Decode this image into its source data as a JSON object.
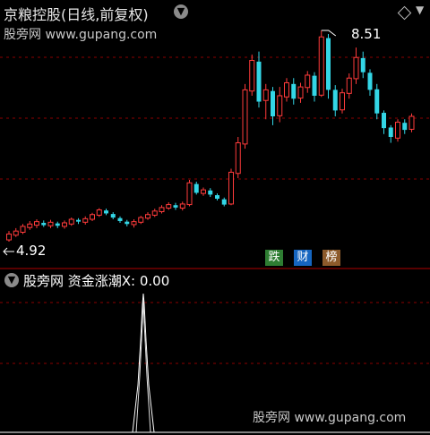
{
  "header": {
    "title": "京粮控股(日线,前复权)"
  },
  "watermark": {
    "top": "股旁网 www.gupang.com",
    "bottom": "股旁网 www.gupang.com"
  },
  "price_labels": {
    "high": "8.51",
    "low": "4.92"
  },
  "badges": [
    "跌",
    "财",
    "榜"
  ],
  "indicator": {
    "title": "股旁网 资金涨潮X: 0.00"
  },
  "icons": {
    "dropdown": "chevron-down-icon",
    "window": "diamond-icon"
  },
  "colors": {
    "up": "#ff3b3b",
    "down": "#33d6e6",
    "grid": "#8b0000",
    "separator": "#b00000"
  },
  "chart_data": {
    "type": "candlestick",
    "ylim": [
      4.92,
      8.51
    ],
    "high": 8.51,
    "low": 4.92,
    "candles": [
      [
        4.95,
        5.05,
        4.92,
        5.1
      ],
      [
        5.03,
        5.1,
        5.0,
        5.15
      ],
      [
        5.08,
        5.18,
        5.05,
        5.22
      ],
      [
        5.16,
        5.22,
        5.12,
        5.27
      ],
      [
        5.2,
        5.26,
        5.15,
        5.3
      ],
      [
        5.24,
        5.2,
        5.17,
        5.28
      ],
      [
        5.19,
        5.25,
        5.15,
        5.29
      ],
      [
        5.23,
        5.19,
        5.15,
        5.26
      ],
      [
        5.18,
        5.24,
        5.14,
        5.28
      ],
      [
        5.22,
        5.3,
        5.19,
        5.33
      ],
      [
        5.29,
        5.26,
        5.22,
        5.32
      ],
      [
        5.25,
        5.31,
        5.21,
        5.35
      ],
      [
        5.3,
        5.38,
        5.27,
        5.41
      ],
      [
        5.37,
        5.46,
        5.34,
        5.49
      ],
      [
        5.45,
        5.4,
        5.37,
        5.48
      ],
      [
        5.39,
        5.33,
        5.3,
        5.42
      ],
      [
        5.32,
        5.27,
        5.24,
        5.35
      ],
      [
        5.26,
        5.22,
        5.18,
        5.29
      ],
      [
        5.21,
        5.26,
        5.16,
        5.3
      ],
      [
        5.25,
        5.33,
        5.22,
        5.36
      ],
      [
        5.32,
        5.38,
        5.29,
        5.42
      ],
      [
        5.37,
        5.44,
        5.34,
        5.48
      ],
      [
        5.43,
        5.5,
        5.4,
        5.54
      ],
      [
        5.49,
        5.55,
        5.46,
        5.59
      ],
      [
        5.54,
        5.5,
        5.46,
        5.58
      ],
      [
        5.49,
        5.56,
        5.45,
        5.6
      ],
      [
        5.55,
        5.92,
        5.52,
        5.97
      ],
      [
        5.9,
        5.75,
        5.72,
        5.94
      ],
      [
        5.74,
        5.8,
        5.7,
        5.84
      ],
      [
        5.79,
        5.72,
        5.68,
        5.83
      ],
      [
        5.71,
        5.65,
        5.62,
        5.74
      ],
      [
        5.64,
        5.55,
        5.52,
        5.67
      ],
      [
        5.56,
        6.1,
        5.54,
        6.16
      ],
      [
        6.08,
        6.6,
        6.0,
        6.7
      ],
      [
        6.58,
        7.5,
        6.5,
        7.6
      ],
      [
        7.48,
        8.0,
        7.4,
        8.1
      ],
      [
        7.98,
        7.3,
        7.2,
        8.15
      ],
      [
        7.32,
        7.5,
        7.0,
        7.6
      ],
      [
        7.48,
        7.05,
        6.9,
        7.55
      ],
      [
        7.06,
        7.4,
        6.95,
        7.55
      ],
      [
        7.38,
        7.62,
        7.3,
        7.7
      ],
      [
        7.6,
        7.35,
        7.25,
        7.7
      ],
      [
        7.36,
        7.55,
        7.28,
        7.62
      ],
      [
        7.54,
        7.75,
        7.45,
        7.82
      ],
      [
        7.74,
        7.4,
        7.3,
        7.8
      ],
      [
        7.41,
        8.4,
        7.38,
        8.51
      ],
      [
        8.38,
        7.5,
        7.35,
        8.45
      ],
      [
        7.5,
        7.15,
        7.05,
        7.58
      ],
      [
        7.16,
        7.45,
        7.1,
        7.52
      ],
      [
        7.44,
        7.7,
        7.35,
        7.78
      ],
      [
        7.69,
        8.05,
        7.6,
        8.22
      ],
      [
        8.04,
        7.8,
        7.7,
        8.15
      ],
      [
        7.79,
        7.5,
        7.4,
        7.85
      ],
      [
        7.51,
        7.1,
        7.0,
        7.6
      ],
      [
        7.11,
        6.85,
        6.75,
        7.15
      ],
      [
        6.86,
        6.7,
        6.6,
        6.9
      ],
      [
        6.68,
        6.95,
        6.62,
        7.0
      ],
      [
        6.94,
        6.82,
        6.75,
        7.0
      ],
      [
        6.83,
        7.05,
        6.78,
        7.1
      ]
    ]
  }
}
